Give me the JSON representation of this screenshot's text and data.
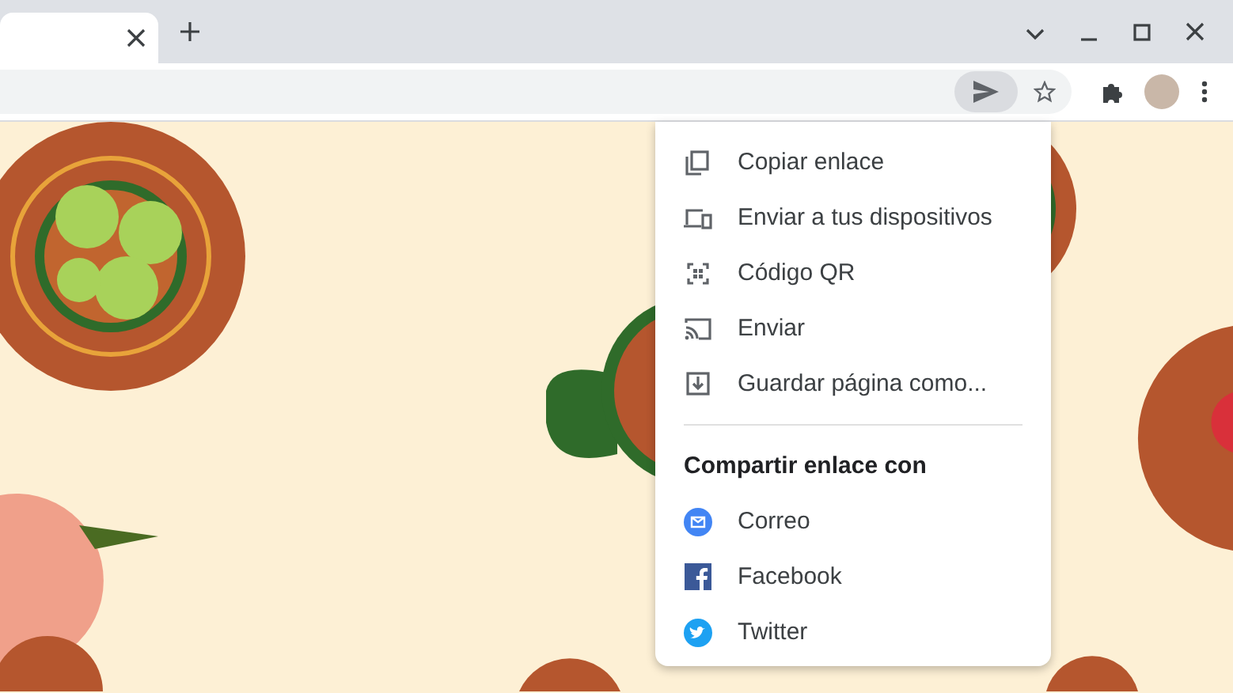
{
  "tabs": [
    {
      "selected": true
    }
  ],
  "share_menu": {
    "actions": [
      {
        "label": "Copiar enlace"
      },
      {
        "label": "Enviar a tus dispositivos"
      },
      {
        "label": "Código QR"
      },
      {
        "label": "Enviar"
      },
      {
        "label": "Guardar página como..."
      }
    ],
    "heading": "Compartir enlace con",
    "targets": [
      {
        "label": "Correo",
        "color": "#4285f4"
      },
      {
        "label": "Facebook",
        "color": "#3b5998"
      },
      {
        "label": "Twitter",
        "color": "#1da1f2"
      }
    ]
  }
}
